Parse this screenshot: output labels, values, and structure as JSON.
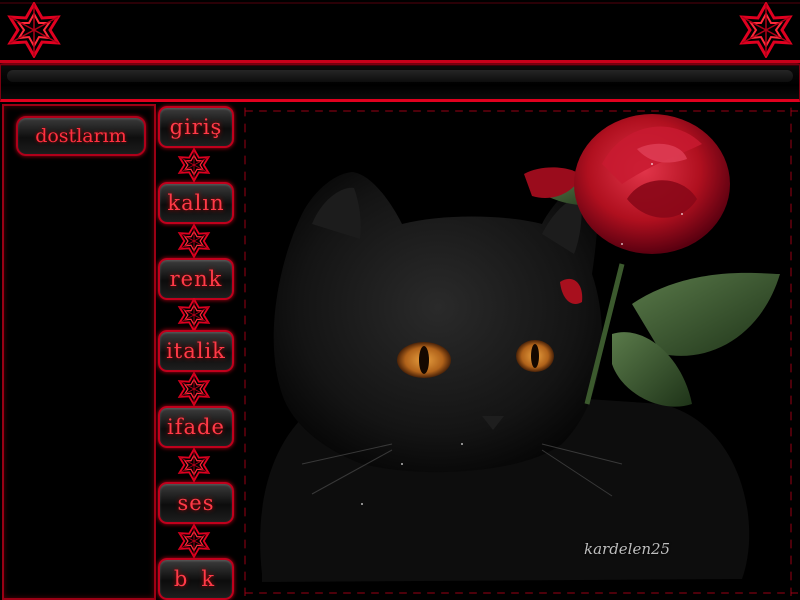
{
  "sidebar": {
    "friends_label": "dostlarım"
  },
  "menu": {
    "items": [
      {
        "label": "giriş"
      },
      {
        "label": "kalın"
      },
      {
        "label": "renk"
      },
      {
        "label": "italik"
      },
      {
        "label": "ifade"
      },
      {
        "label": "ses"
      },
      {
        "label": "bk"
      }
    ]
  },
  "content": {
    "watermark": "kardelen25"
  },
  "colors": {
    "accent": "#e0001e",
    "button_text": "#ff3a48",
    "background": "#000000"
  }
}
